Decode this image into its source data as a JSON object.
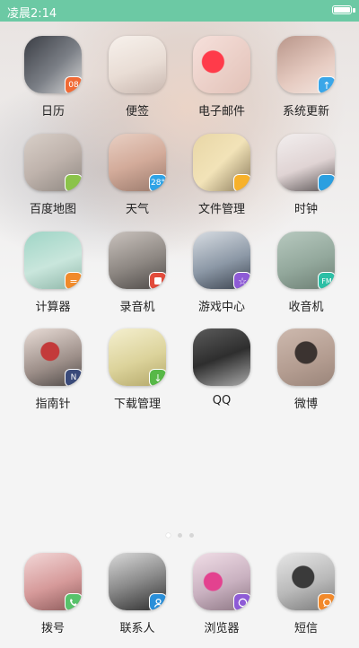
{
  "status": {
    "time": "凌晨2:14"
  },
  "apps": [
    {
      "label": "日历",
      "badge": "08"
    },
    {
      "label": "便签",
      "badge": ""
    },
    {
      "label": "电子邮件",
      "badge": ""
    },
    {
      "label": "系统更新",
      "badge": "↑"
    },
    {
      "label": "百度地图",
      "badge": ""
    },
    {
      "label": "天气",
      "badge": "28°"
    },
    {
      "label": "文件管理",
      "badge": ""
    },
    {
      "label": "时钟",
      "badge": ""
    },
    {
      "label": "计算器",
      "badge": "="
    },
    {
      "label": "录音机",
      "badge": ""
    },
    {
      "label": "游戏中心",
      "badge": "☆"
    },
    {
      "label": "收音机",
      "badge": "FM"
    },
    {
      "label": "指南针",
      "badge": "N"
    },
    {
      "label": "下载管理",
      "badge": "↓"
    },
    {
      "label": "QQ",
      "badge": ""
    },
    {
      "label": "微博",
      "badge": ""
    }
  ],
  "dock": [
    {
      "label": "拨号",
      "badge": ""
    },
    {
      "label": "联系人",
      "badge": ""
    },
    {
      "label": "浏览器",
      "badge": ""
    },
    {
      "label": "短信",
      "badge": ""
    }
  ],
  "colors": {
    "status_bar": "#6cc9a4",
    "calendar_badge": "#f06a35",
    "update_badge": "#3aa6e8",
    "map_badge": "#8bc34a",
    "weather_badge": "#2fa3e6",
    "files_badge": "#f7b12a",
    "clock_badge": "#2b9fe0",
    "calc_badge": "#f08a2a",
    "recorder_badge": "#e24b3b",
    "game_badge": "#8e5bd6",
    "radio_badge": "#2bbfa5",
    "compass_badge": "#3a4a7a",
    "download_badge": "#57b847",
    "phone_badge": "#58c26b",
    "contacts_badge": "#2a8fd9",
    "browser_badge": "#8e5bd6",
    "sms_badge": "#f2892a"
  }
}
